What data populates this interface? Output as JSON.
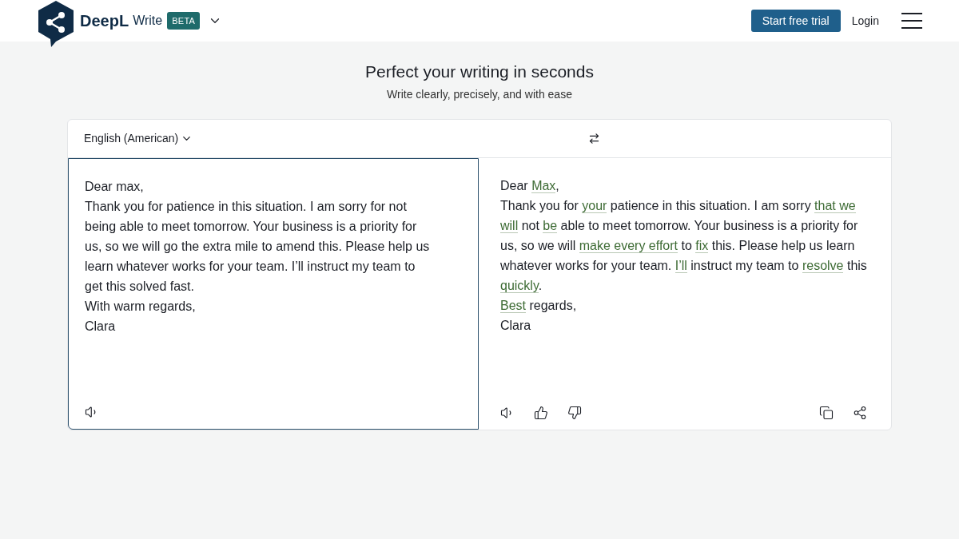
{
  "header": {
    "brand": "DeepL",
    "product": "Write",
    "badge": "BETA",
    "trial_button": "Start free trial",
    "login": "Login"
  },
  "hero": {
    "title": "Perfect your writing in seconds",
    "subtitle": "Write clearly, precisely, and with ease"
  },
  "editor": {
    "language": "English (American)",
    "source": {
      "paragraphs": [
        "Dear max,",
        "Thank you for patience in this situation. I am sorry for not being able to meet tomorrow. Your business is a priority for us, so we will go the extra mile to amend this. Please help us learn whatever works for your team. I’ll instruct my team to get this solved fast.",
        "With warm regards,",
        "Clara"
      ]
    },
    "result": {
      "paragraphs": [
        [
          {
            "text": "Dear ",
            "changed": false
          },
          {
            "text": "Max",
            "changed": true
          },
          {
            "text": ",",
            "changed": false
          }
        ],
        [
          {
            "text": "Thank you for ",
            "changed": false
          },
          {
            "text": "your",
            "changed": true
          },
          {
            "text": " patience in this situation. I am sorry ",
            "changed": false
          },
          {
            "text": "that we will",
            "changed": true
          },
          {
            "text": " not ",
            "changed": false
          },
          {
            "text": "be",
            "changed": true
          },
          {
            "text": " able to meet tomorrow. Your business is a priority for us, so we will ",
            "changed": false
          },
          {
            "text": "make every effort",
            "changed": true
          },
          {
            "text": " to ",
            "changed": false
          },
          {
            "text": "fix",
            "changed": true
          },
          {
            "text": " this. Please help us learn whatever works for your team. ",
            "changed": false
          },
          {
            "text": "I’ll",
            "changed": true
          },
          {
            "text": " instruct my team to ",
            "changed": false
          },
          {
            "text": "resolve",
            "changed": true
          },
          {
            "text": " this ",
            "changed": false
          },
          {
            "text": "quickly",
            "changed": true
          },
          {
            "text": ".",
            "changed": false
          }
        ],
        [
          {
            "text": "Best",
            "changed": true
          },
          {
            "text": " regards,",
            "changed": false
          }
        ],
        [
          {
            "text": "Clara",
            "changed": false
          }
        ]
      ]
    }
  }
}
